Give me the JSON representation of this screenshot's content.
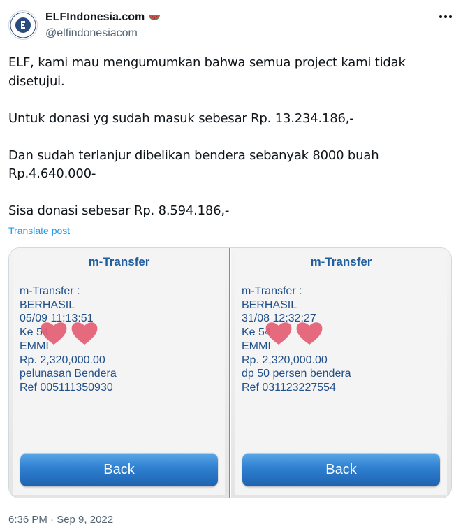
{
  "author": {
    "display_name": "ELFIndonesia.com",
    "handle": "@elfindonesiacom",
    "badge_icon": "watermelon-icon",
    "avatar_icon": "elf-logo-icon"
  },
  "tweet": {
    "text": "ELF, kami mau mengumumkan bahwa semua project kami tidak\ndisetujui.\n\nUntuk donasi yg sudah masuk sebesar Rp. 13.234.186,-\n\nDan sudah terlanjur dibelikan bendera sebanyak 8000 buah\nRp.4.640.000-\n\nSisa donasi sebesar Rp. 8.594.186,-",
    "translate_label": "Translate post",
    "timestamp": "6:36 PM · Sep 9, 2022"
  },
  "media": [
    {
      "title": "m-Transfer",
      "lines": [
        "m-Transfer :",
        "BERHASIL",
        "05/09 11:13:51",
        "Ke 54",
        "EMMI",
        "Rp. 2,320,000.00",
        "pelunasan Bendera",
        "Ref 005111350930"
      ],
      "back_label": "Back"
    },
    {
      "title": "m-Transfer",
      "lines": [
        "m-Transfer :",
        "BERHASIL",
        "31/08 12:32:27",
        "Ke 54",
        "EMMI",
        "Rp. 2,320,000.00",
        "dp 50 persen bendera",
        "Ref 031123227554"
      ],
      "back_label": "Back"
    }
  ],
  "colors": {
    "link": "#1d9bf0",
    "muted": "#536471",
    "bank_text": "#21508a",
    "button_blue": "#2f7fd0",
    "heart": "#e05b6f"
  }
}
